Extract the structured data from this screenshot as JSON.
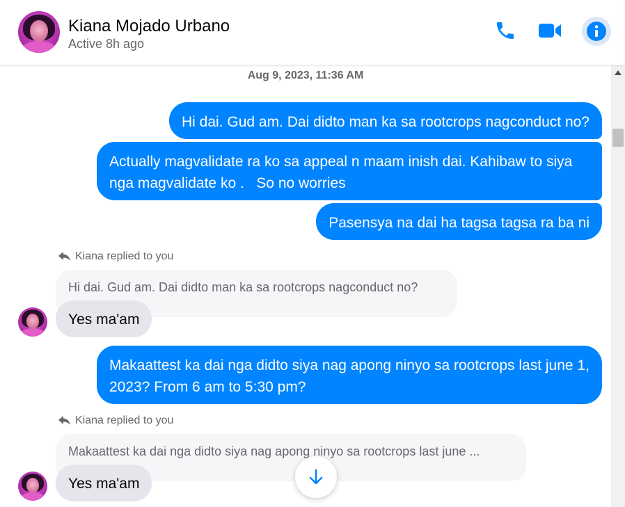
{
  "header": {
    "contact_name": "Kiana Mojado Urbano",
    "status": "Active 8h ago",
    "icons": [
      "phone-icon",
      "video-camera-icon",
      "info-icon"
    ],
    "accent_color": "#0084ff"
  },
  "conversation": {
    "timestamp": "Aug 9, 2023, 11:36 AM",
    "outgoing_1": "Hi dai. Gud am. Dai didto man ka sa rootcrops nagconduct no?",
    "outgoing_2": "Actually magvalidate ra ko sa appeal n maam inish dai. Kahibaw to siya nga magvalidate ko .   So no worries",
    "outgoing_3": "Pasensya na dai ha tagsa tagsa ra ba ni",
    "reply_1": {
      "note": "Kiana replied to you",
      "quoted": "Hi dai. Gud am. Dai didto man ka sa rootcrops nagconduct no?",
      "text": "Yes ma'am"
    },
    "outgoing_4": "Makaattest ka dai nga didto siya nag apong ninyo sa rootcrops last june 1, 2023? From 6 am to 5:30 pm?",
    "reply_2": {
      "note": "Kiana replied to you",
      "quoted": "Makaattest ka dai nga didto siya nag apong ninyo sa rootcrops last june ...",
      "text": "Yes ma'am"
    }
  }
}
